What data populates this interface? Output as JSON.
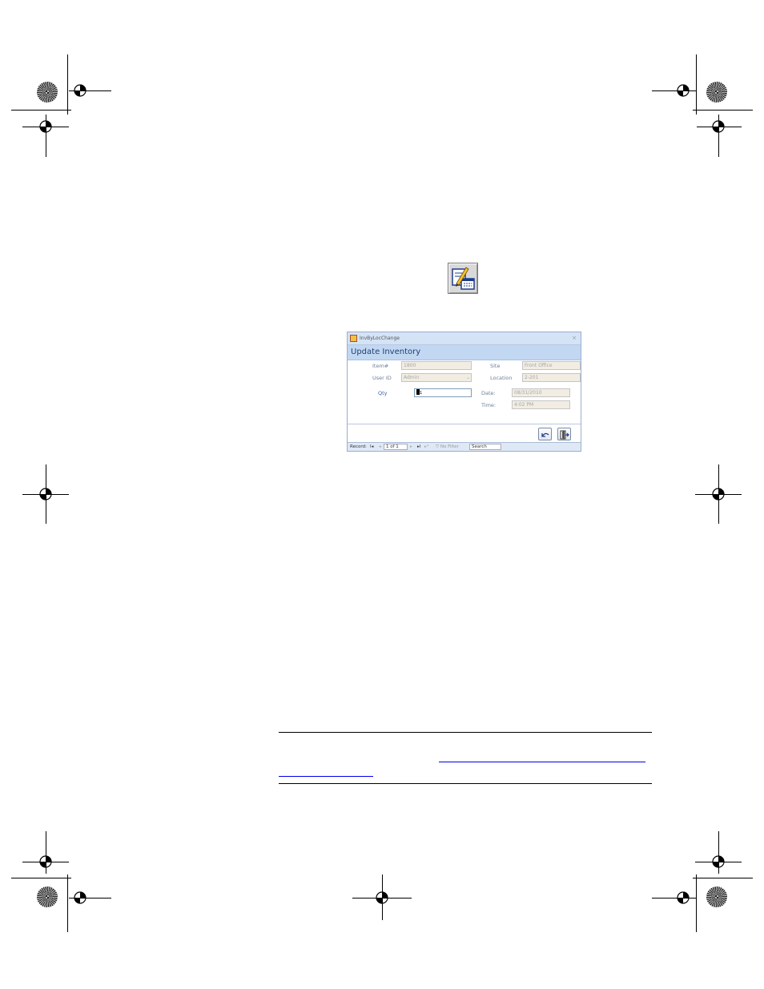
{
  "form": {
    "title": "InvByLocChange",
    "close_glyph": "×",
    "header": "Update Inventory",
    "fields": {
      "item_label": "Item#",
      "item_value": "1800",
      "site_label": "Site",
      "site_value": "Front Office",
      "user_label": "User ID",
      "user_value": "Admin",
      "location_label": "Location",
      "location_value": "2-201",
      "qty_label": "Qty",
      "qty_value": "1",
      "date_label": "Date:",
      "date_value": "08/31/2010",
      "time_label": "Time:",
      "time_value": "4:02 PM"
    },
    "buttons": {
      "undo_icon": "undo-icon",
      "exit_icon": "exit-door-icon"
    },
    "nav": {
      "record_label": "Record:",
      "first": "I◂",
      "prev": "◂",
      "position": "1 of 1",
      "next": "▸",
      "last": "▸I",
      "new": "▸*",
      "filter": "No Filter",
      "search": "Search"
    }
  },
  "colors": {
    "form_header_bg": "#c2d8f2",
    "form_header_text": "#1f3f75",
    "link": "#0000ee"
  }
}
